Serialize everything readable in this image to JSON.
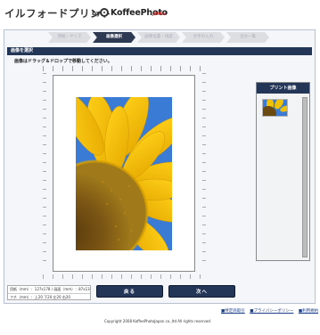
{
  "header": {
    "title": "イルフォードプリント",
    "by": "by",
    "brand": "KoffeePhoto",
    "brand_sub": "JAPAN"
  },
  "steps": [
    {
      "label": "用紙・サイズ",
      "active": false
    },
    {
      "label": "画像選択",
      "active": true
    },
    {
      "label": "画像位置・角度",
      "active": false
    },
    {
      "label": "文字の入力",
      "active": false
    },
    {
      "label": "注文一覧",
      "active": false
    }
  ],
  "section": {
    "title": "画像を選択",
    "instruction": "画像はドラッグ＆ドロップで移動してください。"
  },
  "side_panel": {
    "title": "プリント画像"
  },
  "info": {
    "row1": "用紙（mm）：127x178 / 画面（mm）：87x138",
    "row2": "フチ（mm）：上20 下20 左20 右20"
  },
  "buttons": {
    "back": "戻る",
    "next": "次へ"
  },
  "footer": {
    "links": [
      "■特定商取引",
      "■プライバシーポリシー",
      "■利用規約"
    ],
    "copyright": "Copyright 2008 KoffeePhotoJapan co.,ltd All rights reserved."
  },
  "colors": {
    "navy": "#243658",
    "petal": "#f2c200",
    "sky": "#3d7ed8",
    "seed": "#6b4a12"
  }
}
